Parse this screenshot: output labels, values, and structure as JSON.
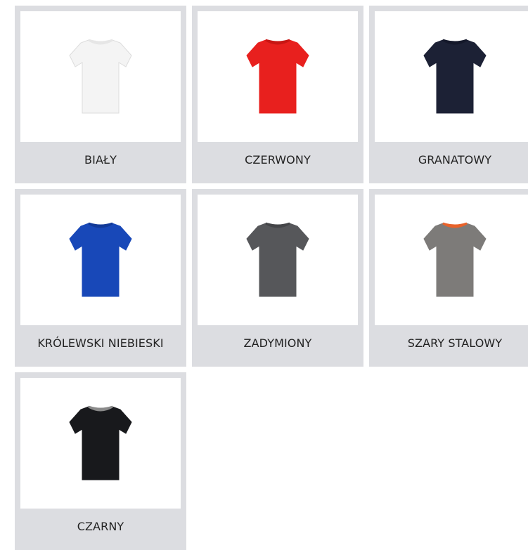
{
  "swatches": [
    {
      "label": "BIAŁY",
      "icon": "tshirt-icon",
      "color": "#f4f4f4",
      "collar": "#e6e6e6"
    },
    {
      "label": "CZERWONY",
      "icon": "tshirt-icon",
      "color": "#e8201e",
      "collar": "#c81614"
    },
    {
      "label": "GRANATOWY",
      "icon": "tshirt-icon",
      "color": "#1c2135",
      "collar": "#14182a"
    },
    {
      "label": "KRÓLEWSKI NIEBIESKI",
      "icon": "tshirt-icon",
      "color": "#1848b8",
      "collar": "#123a98"
    },
    {
      "label": "ZADYMIONY",
      "icon": "tshirt-icon",
      "color": "#56575a",
      "collar": "#444548"
    },
    {
      "label": "SZARY STALOWY",
      "icon": "tshirt-icon",
      "color": "#7d7b79",
      "collar": "#e8622a"
    },
    {
      "label": "CZARNY",
      "icon": "tshirt-icon",
      "color": "#18191c",
      "collar": "#8a8a8a"
    }
  ]
}
